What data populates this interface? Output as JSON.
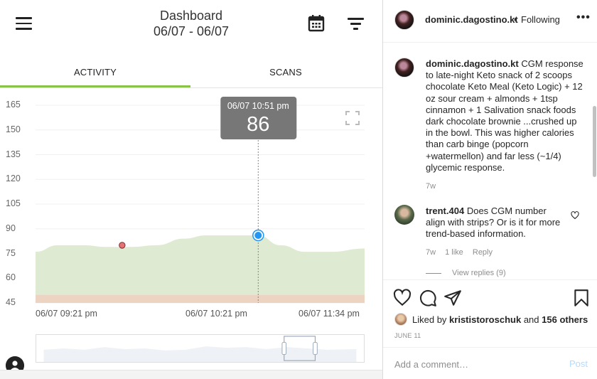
{
  "app": {
    "title": "Dashboard",
    "date_range": "06/07 - 06/07",
    "tabs": [
      {
        "label": "ACTIVITY",
        "active": true
      },
      {
        "label": "SCANS",
        "active": false
      }
    ],
    "accent_color": "#8bc34a",
    "icons": {
      "menu": "hamburger-icon",
      "calendar": "calendar-icon",
      "filter": "filter-icon",
      "expand": "fullscreen-icon",
      "avatar": "user-avatar-icon"
    }
  },
  "chart_data": {
    "type": "area",
    "yticks": [
      "165",
      "150",
      "135",
      "120",
      "105",
      "90",
      "75",
      "60",
      "45"
    ],
    "ylim": [
      45,
      165
    ],
    "xtick_labels": [
      "06/07 09:21 pm",
      "06/07 10:21 pm",
      "06/07 11:34 pm"
    ],
    "x": [
      "09:21",
      "09:30",
      "09:40",
      "09:50",
      "10:00",
      "10:10",
      "10:21",
      "10:30",
      "10:40",
      "10:51",
      "11:00",
      "11:10",
      "11:20",
      "11:34"
    ],
    "series": [
      {
        "values": [
          76,
          80,
          80,
          79,
          79,
          80,
          84,
          86,
          86,
          86,
          80,
          76,
          76,
          78
        ],
        "color": "#dfead3"
      }
    ],
    "low_band": {
      "from": 45,
      "to": 50,
      "color": "#ecd3c2"
    },
    "markers": [
      {
        "x": "09:56",
        "y": 80,
        "color": "#e57373"
      },
      {
        "x": "10:51",
        "y": 86,
        "color": "#2196f3"
      }
    ],
    "tooltip": {
      "time": "06/07 10:51 pm",
      "value": "86"
    }
  },
  "post": {
    "username": "dominic.dagostino.kt",
    "separator": "•",
    "follow_state": "Following",
    "more_label": "•••",
    "caption_user": "dominic.dagostino.kt",
    "caption_text": "CGM response to late-night Keto snack of 2 scoops chocolate Keto Meal (Keto Logic) + 12 oz sour cream + almonds + 1tsp cinnamon + 1 Salivation snack foods dark chocolate brownie ...crushed up in the bowl. This was higher calories than carb binge (popcorn +watermellon) and far less (~1/4) glycemic response.",
    "caption_time": "7w",
    "comments": [
      {
        "user": "trent.404",
        "text": "Does CGM number align with strips? Or is it for more trend-based information.",
        "time": "7w",
        "likes": "1 like",
        "reply": "Reply",
        "view_replies": "View replies (9)"
      }
    ],
    "liked_by_prefix": "Liked by",
    "liked_by_user": "krististoroschuk",
    "liked_by_and": "and",
    "liked_by_others": "156 others",
    "date": "JUNE 11",
    "comment_placeholder": "Add a comment…",
    "post_label": "Post",
    "icons": {
      "like": "heart-icon",
      "comment": "comment-icon",
      "share": "share-icon",
      "save": "bookmark-icon"
    }
  }
}
